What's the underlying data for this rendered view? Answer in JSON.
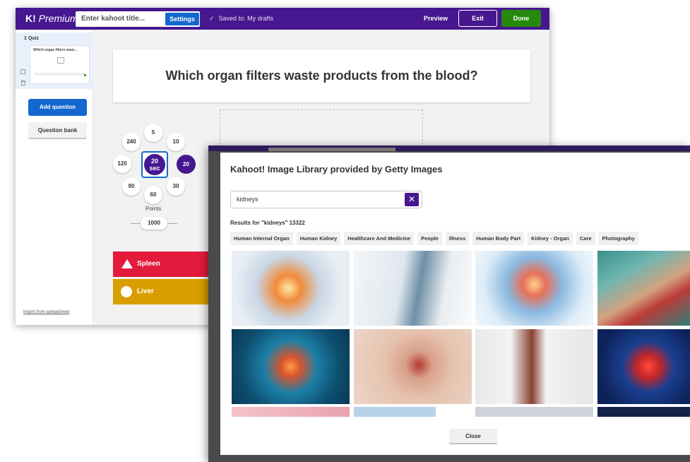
{
  "editor": {
    "logo_brand": "K!",
    "logo_plan": "Premium",
    "title_placeholder": "Enter kahoot title...",
    "settings_label": "Settings",
    "saved_status": "Saved to: My drafts",
    "preview_label": "Preview",
    "exit_label": "Exit",
    "done_label": "Done",
    "sidebar": {
      "slide_label": "1  Quiz",
      "slide_title": "Which organ filters wast...",
      "add_question_label": "Add question",
      "question_bank_label": "Question bank",
      "import_label": "Import from spreadsheet"
    },
    "question_text": "Which organ filters waste products from the blood?",
    "time_limits": [
      "5",
      "10",
      "20",
      "30",
      "60",
      "90",
      "120",
      "240"
    ],
    "time_selected_value": "20",
    "time_selected_unit": "sec",
    "points_label": "Points",
    "points_value": "1000",
    "answers": [
      {
        "text": "Spleen",
        "shape": "triangle",
        "color": "#e21b3c"
      },
      {
        "text": "Liver",
        "shape": "circle",
        "color": "#d89e00"
      }
    ]
  },
  "modal": {
    "title": "Kahoot! Image Library provided by Getty Images",
    "search_value": "kidneys",
    "results_text": "Results for \"kidneys\" 13322",
    "tags": [
      "Human Internal Organ",
      "Human Kidney",
      "Healthcare And Medicine",
      "People",
      "Illness",
      "Human Body Part",
      "Kidney - Organ",
      "Care",
      "Photography"
    ],
    "close_label": "Close"
  },
  "colors": {
    "brand_purple": "#46178f",
    "primary_blue": "#1368ce",
    "done_green": "#26890c"
  }
}
